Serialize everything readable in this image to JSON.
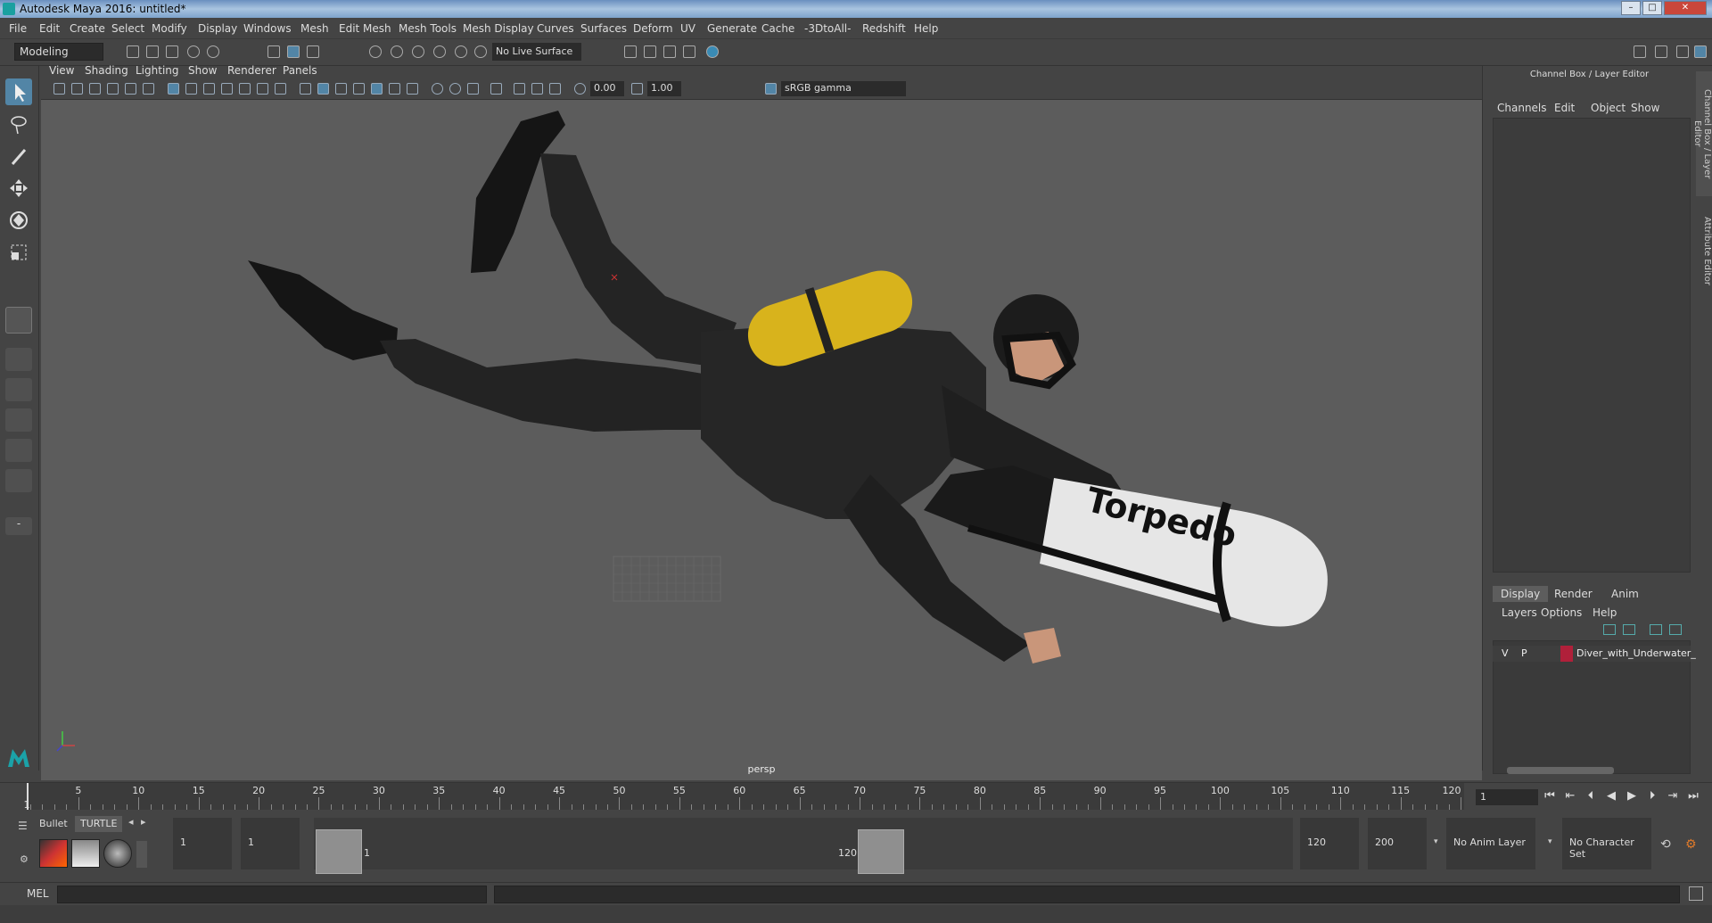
{
  "window": {
    "title": "Autodesk Maya 2016: untitled*"
  },
  "menubar": {
    "items": [
      "File",
      "Edit",
      "Create",
      "Select",
      "Modify",
      "Display",
      "Windows",
      "Mesh",
      "Edit Mesh",
      "Mesh Tools",
      "Mesh Display",
      "Curves",
      "Surfaces",
      "Deform",
      "UV",
      "Generate",
      "Cache",
      "-3DtoAll-",
      "Redshift",
      "Help"
    ]
  },
  "statusline": {
    "mode": "Modeling",
    "live_surface": "No Live Surface"
  },
  "panel": {
    "menu": [
      "View",
      "Shading",
      "Lighting",
      "Show",
      "Renderer",
      "Panels"
    ],
    "exposure": "0.00",
    "gamma_value": "1.00",
    "color_space": "sRGB gamma",
    "camera_label": "persp"
  },
  "scene": {
    "torpedo_text": "Torpedo"
  },
  "channelbox": {
    "title": "Channel Box / Layer Editor",
    "menu": [
      "Channels",
      "Edit",
      "Object",
      "Show"
    ],
    "tabs": [
      "Display",
      "Render",
      "Anim"
    ],
    "layer_menu": [
      "Layers",
      "Options",
      "Help"
    ],
    "layer": {
      "v": "V",
      "p": "P",
      "name": "Diver_with_Underwater_",
      "color": "#b0203a"
    },
    "side_tabs": [
      "Channel Box / Layer Editor",
      "Attribute Editor"
    ]
  },
  "timeslider": {
    "ticks": [
      "5",
      "10",
      "15",
      "20",
      "25",
      "30",
      "35",
      "40",
      "45",
      "50",
      "55",
      "60",
      "65",
      "70",
      "75",
      "80",
      "85",
      "90",
      "95",
      "100",
      "105",
      "110",
      "115",
      "120"
    ],
    "start_label": "1",
    "current_frame": "1"
  },
  "rangebar": {
    "shelf_tabs": [
      "Bullet",
      "TURTLE"
    ],
    "start_time": "1",
    "playback_start": "1",
    "range_start_label": "1",
    "range_end_label": "120",
    "playback_end": "120",
    "end_time": "200",
    "anim_layer": "No Anim Layer",
    "character_set": "No Character Set"
  },
  "commandline": {
    "label": "MEL"
  },
  "colors": {
    "accent": "#5285a6",
    "viewport_bg": "#5c5c5c",
    "tank": "#d8b31c",
    "suit": "#1f1f1f",
    "layer": "#b0203a"
  }
}
